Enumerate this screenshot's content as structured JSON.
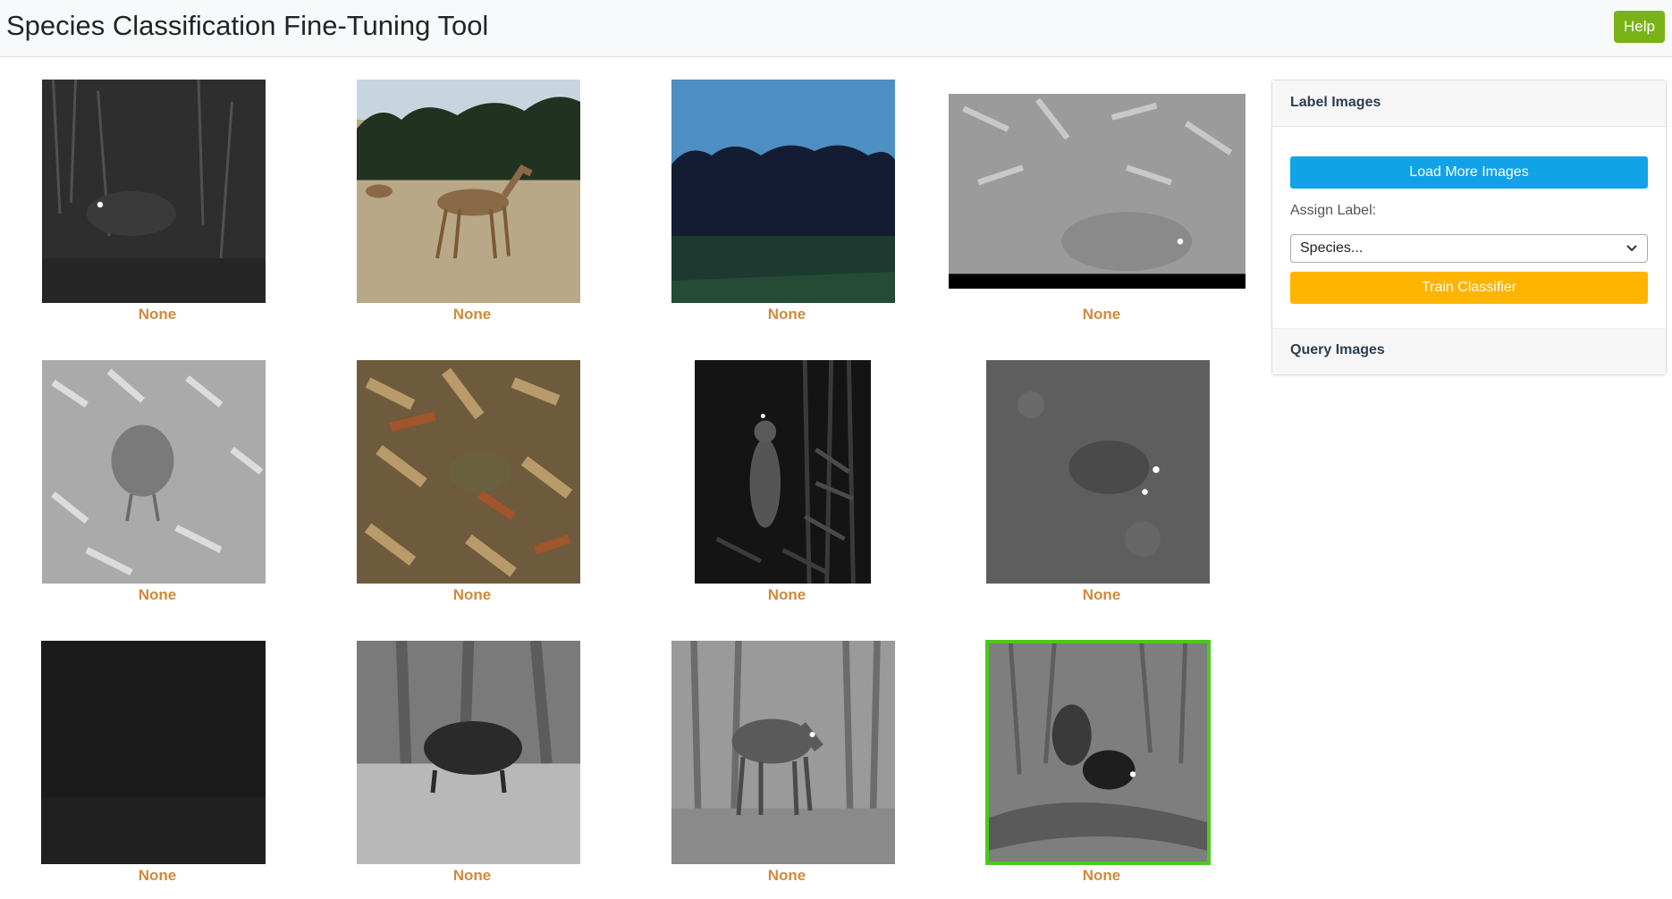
{
  "header": {
    "title": "Species Classification Fine-Tuning Tool",
    "help_label": "Help"
  },
  "images": [
    {
      "label": "None",
      "scene": "night-forest-dark"
    },
    {
      "label": "None",
      "scene": "antelope-sandy-plain"
    },
    {
      "label": "None",
      "scene": "dark-herd-blue-sky"
    },
    {
      "label": "None",
      "scene": "rodent-grayscale-leaves"
    },
    {
      "label": "None",
      "scene": "bird-grayscale-leaves"
    },
    {
      "label": "None",
      "scene": "animal-brown-leaves"
    },
    {
      "label": "None",
      "scene": "animal-night-vertical"
    },
    {
      "label": "None",
      "scene": "animal-gray-eyeshine"
    },
    {
      "label": "None",
      "scene": "near-black-night"
    },
    {
      "label": "None",
      "scene": "boar-grayscale-forest"
    },
    {
      "label": "None",
      "scene": "deer-grayscale-forest"
    },
    {
      "label": "None",
      "scene": "squirrel-on-log",
      "selected": true
    }
  ],
  "panel": {
    "header": "Label Images",
    "load_more_label": "Load More Images",
    "assign_label_text": "Assign Label:",
    "species_select_value": "Species...",
    "train_label": "Train Classifier",
    "query_label": "Query Images"
  },
  "colors": {
    "help_button": "#7ab317",
    "load_button": "#11a2e8",
    "train_button": "#ffb400",
    "caption": "#d08a3c",
    "selected_border": "#4cc91e"
  }
}
